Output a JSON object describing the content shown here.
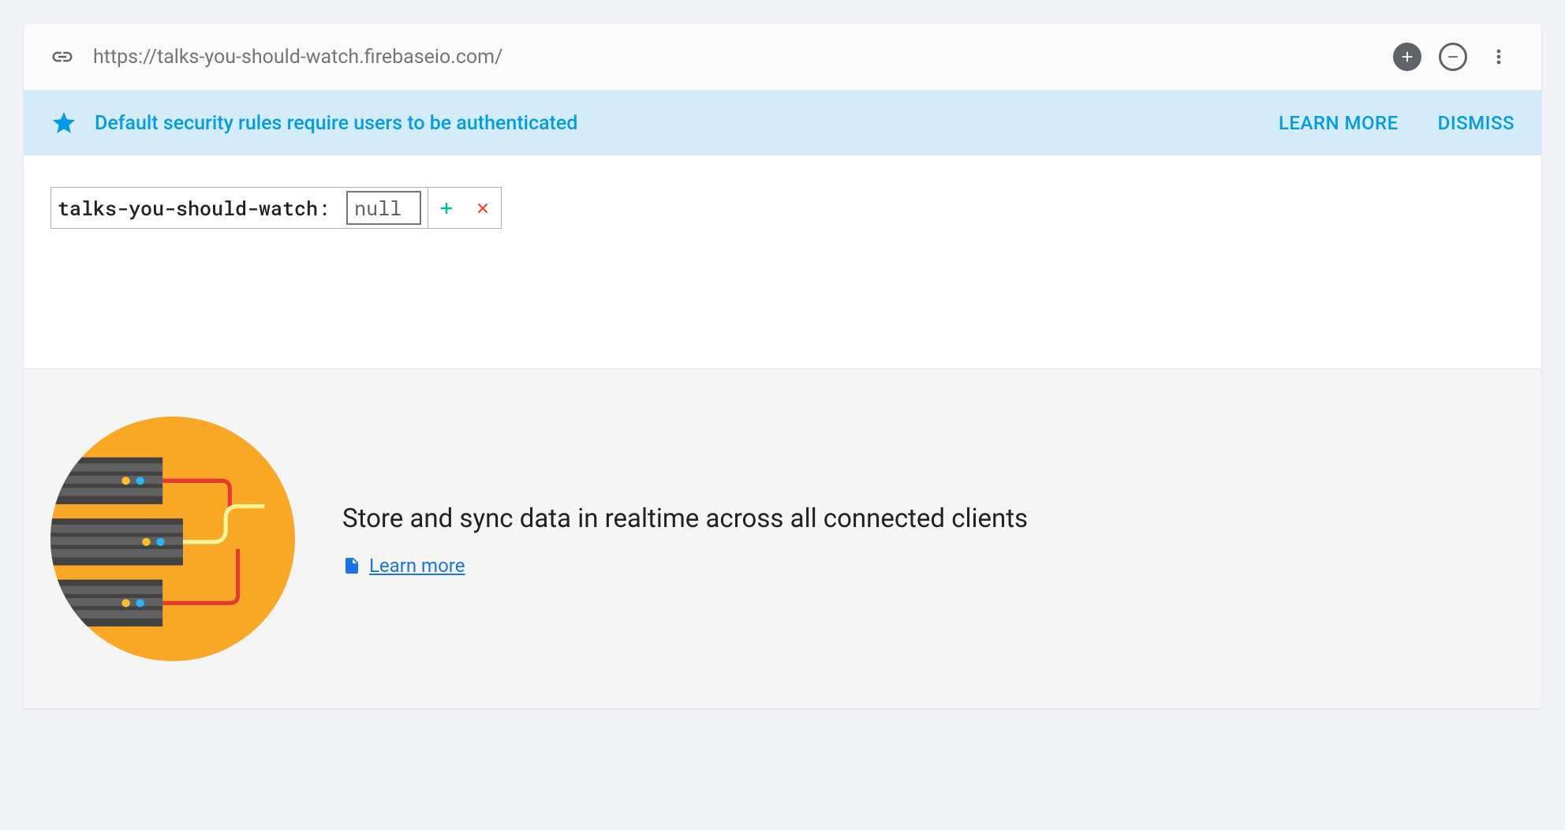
{
  "header": {
    "url": "https://talks-you-should-watch.firebaseio.com/"
  },
  "banner": {
    "message": "Default security rules require users to be authenticated",
    "learn_more": "LEARN MORE",
    "dismiss": "DISMISS"
  },
  "data": {
    "key": "talks-you-should-watch",
    "value": "null"
  },
  "info": {
    "text": "Store and sync data in realtime across all connected clients",
    "learn_more": "Learn more"
  }
}
